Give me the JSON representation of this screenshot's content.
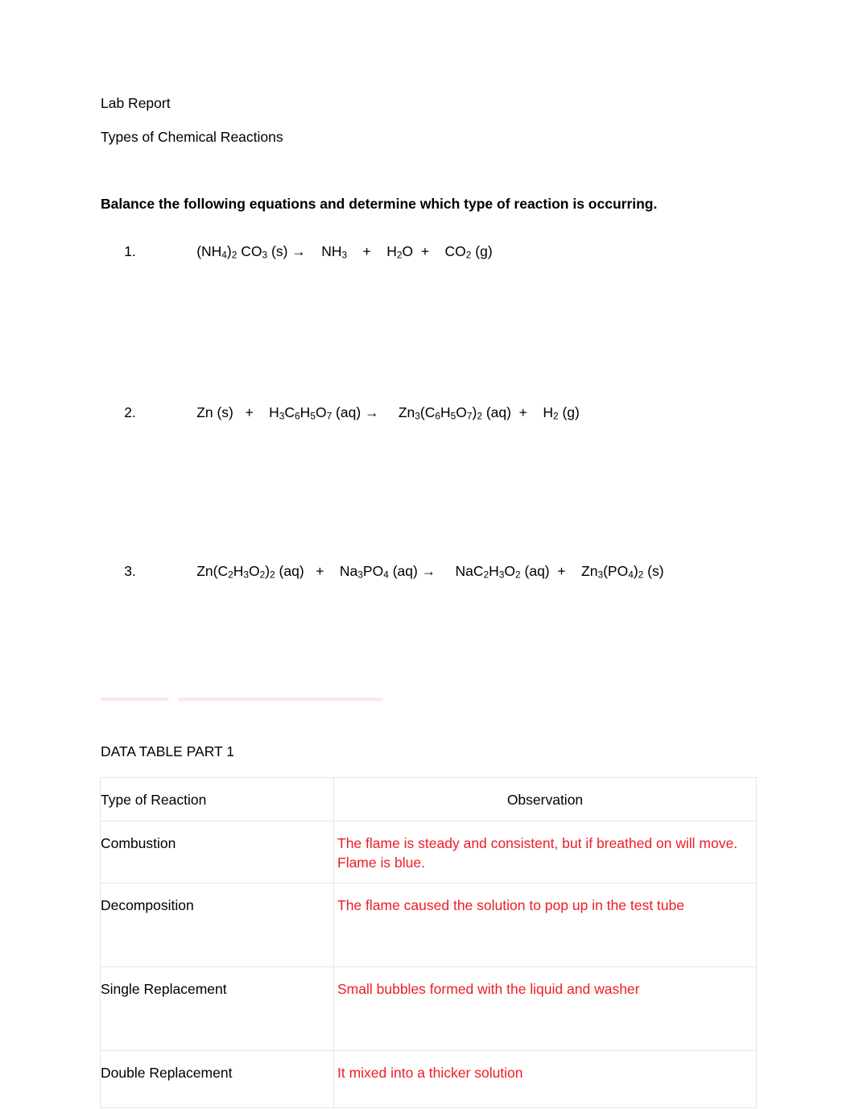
{
  "document": {
    "title": "Lab Report",
    "subtitle": "Types of Chemical Reactions",
    "instruction": "Balance the following equations and determine which type of reaction is occurring."
  },
  "equations": [
    {
      "number": "1.",
      "reactants": "(NH4)2 CO3 (s)",
      "products": "NH3   +    H2O  +    CO2 (g)",
      "full_text": "(NH4)2 CO3 (s) →    NH3   +    H2O  +    CO2 (g)"
    },
    {
      "number": "2.",
      "reactants": "Zn (s)   +    H3C6H5O7 (aq)",
      "products": "Zn3(C6H5O7)2 (aq)  +    H2 (g)",
      "full_text": "Zn (s)   +    H3C6H5O7 (aq) →     Zn3(C6H5O7)2 (aq)  +    H2 (g)"
    },
    {
      "number": "3.",
      "reactants": "Zn(C2H3O2)2 (aq)   +    Na3PO4 (aq)",
      "products": "NaC2H3O2 (aq)  +    Zn3(PO4)2 (s)",
      "full_text": "Zn(C2H3O2)2 (aq)   +    Na3PO4 (aq) →     NaC2H3O2 (aq)  +    Zn3(PO4)2 (s)"
    }
  ],
  "data_table": {
    "caption": "DATA TABLE PART 1",
    "headers": [
      "Type of Reaction",
      "Observation"
    ],
    "rows": [
      {
        "type": "Combustion",
        "observation": "The flame is steady and consistent, but if breathed on will move. Flame is blue."
      },
      {
        "type": "Decomposition",
        "observation": "The flame caused the solution to pop up in the test tube"
      },
      {
        "type": "Single Replacement",
        "observation": "Small bubbles formed with the liquid and washer"
      },
      {
        "type": "Double Replacement",
        "observation": "It mixed into a thicker solution"
      }
    ]
  },
  "colors": {
    "text": "#000000",
    "answer_red": "#ee1c25",
    "table_border": "#e6e6e6",
    "page_background": "#ffffff"
  }
}
